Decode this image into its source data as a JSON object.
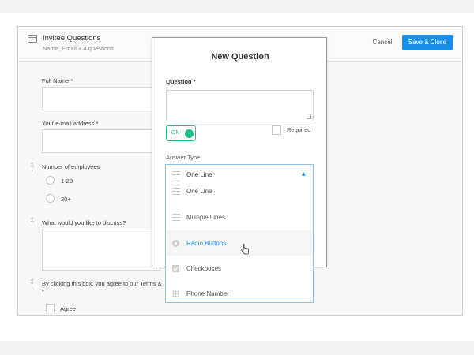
{
  "header": {
    "title": "Invitee Questions",
    "subtitle": "Name, Email + 4 questions",
    "cancel_label": "Cancel",
    "save_label": "Save & Close"
  },
  "form": {
    "full_name_label": "Full Name *",
    "email_label": "Your e-mail address *",
    "employees_label": "Number of employees",
    "employee_options": [
      "1-20",
      "20+"
    ],
    "discuss_label": "What would you like to discuss?",
    "terms_label": "By clicking this box, you agree to our Terms &",
    "terms_required_mark": "*",
    "agree_label": "Agree"
  },
  "modal": {
    "title": "New Question",
    "question_label": "Question *",
    "question_value": "",
    "toggle_label": "ON",
    "toggle_on": true,
    "required_label": "Required",
    "required_checked": false,
    "answer_type_label": "Answer Type",
    "answer_type_selected": "One Line",
    "options": [
      {
        "label": "One Line",
        "icon": "one-line-icon"
      },
      {
        "label": "Multiple Lines",
        "icon": "multiple-lines-icon"
      },
      {
        "label": "Radio Buttons",
        "icon": "radio-icon"
      },
      {
        "label": "Checkboxes",
        "icon": "checkbox-icon"
      },
      {
        "label": "Phone Number",
        "icon": "phone-grid-icon"
      }
    ],
    "hovered_option": "Radio Buttons"
  },
  "colors": {
    "accent": "#1a8ee6",
    "toggle_green": "#1bc28a",
    "dropdown_border": "#8fc3ee"
  }
}
